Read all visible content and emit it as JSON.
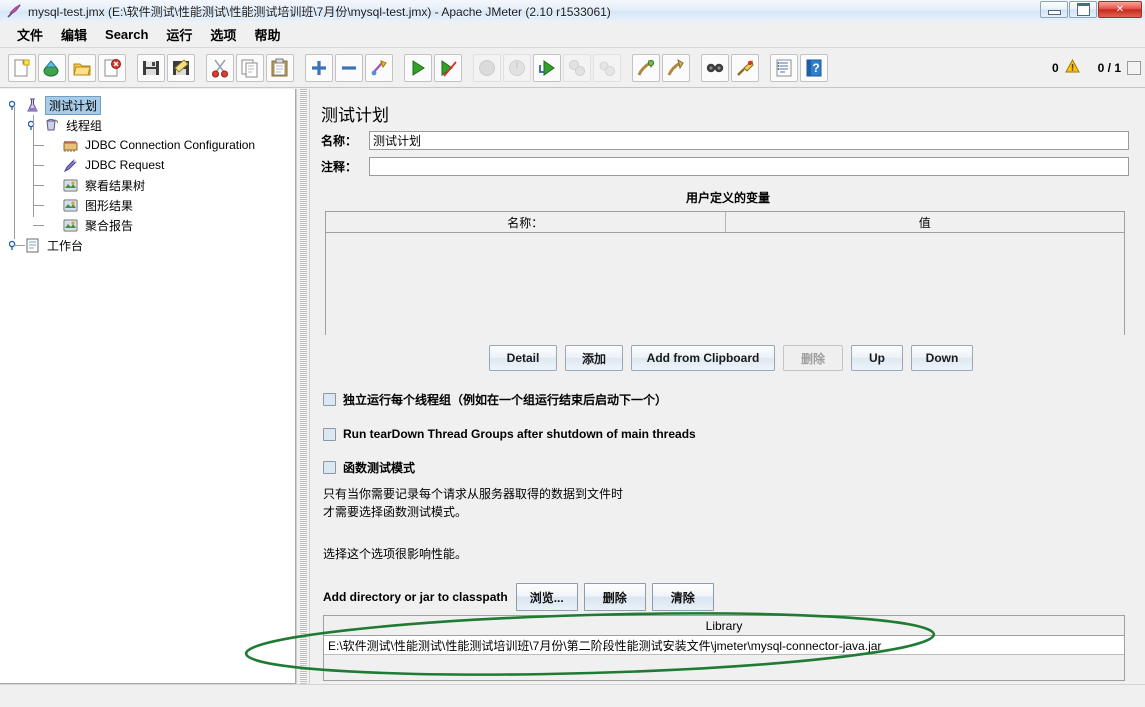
{
  "window": {
    "title": "mysql-test.jmx (E:\\软件测试\\性能测试\\性能测试培训班\\7月份\\mysql-test.jmx) - Apache JMeter (2.10 r1533061)",
    "icon": "jmeter-feather-icon",
    "minimize_label": "minimize",
    "maximize_label": "maximize",
    "close_label": "✕"
  },
  "menubar": {
    "items": [
      {
        "label": "文件",
        "name": "menu-file"
      },
      {
        "label": "编辑",
        "name": "menu-edit"
      },
      {
        "label": "Search",
        "name": "menu-search"
      },
      {
        "label": "运行",
        "name": "menu-run"
      },
      {
        "label": "选项",
        "name": "menu-options"
      },
      {
        "label": "帮助",
        "name": "menu-help"
      }
    ]
  },
  "toolbar": {
    "buttons": [
      {
        "name": "new-icon",
        "enabled": true
      },
      {
        "name": "templates-icon",
        "enabled": true
      },
      {
        "name": "open-icon",
        "enabled": true
      },
      {
        "name": "close-icon",
        "enabled": true
      },
      {
        "name": "save-icon",
        "enabled": true
      },
      {
        "name": "save-as-icon",
        "enabled": true
      },
      {
        "name": "cut-icon",
        "enabled": true
      },
      {
        "name": "copy-icon",
        "enabled": true
      },
      {
        "name": "paste-icon",
        "enabled": true
      },
      {
        "name": "expand-all-icon",
        "enabled": true
      },
      {
        "name": "collapse-all-icon",
        "enabled": true
      },
      {
        "name": "toggle-icon",
        "enabled": true
      },
      {
        "name": "start-icon",
        "enabled": true
      },
      {
        "name": "start-no-pause-icon",
        "enabled": true
      },
      {
        "name": "stop-icon",
        "enabled": false
      },
      {
        "name": "shutdown-icon",
        "enabled": false
      },
      {
        "name": "start-remote-icon",
        "enabled": true
      },
      {
        "name": "stop-remote-icon",
        "enabled": false
      },
      {
        "name": "shutdown-remote-icon",
        "enabled": false
      },
      {
        "name": "clear-icon",
        "enabled": true
      },
      {
        "name": "clear-all-icon",
        "enabled": true
      },
      {
        "name": "search-icon",
        "enabled": true
      },
      {
        "name": "search-reset-icon",
        "enabled": true
      },
      {
        "name": "function-helper-icon",
        "enabled": true
      },
      {
        "name": "help-icon",
        "enabled": true
      }
    ],
    "warning_count": "0",
    "run_count": "0 / 1"
  },
  "tree": {
    "nodes": [
      {
        "label": "测试计划",
        "icon": "test-plan-icon",
        "depth": 0,
        "selected": true,
        "name": "tree-node-test-plan"
      },
      {
        "label": "线程组",
        "icon": "thread-group-icon",
        "depth": 1,
        "selected": false,
        "name": "tree-node-thread-group"
      },
      {
        "label": "JDBC Connection Configuration",
        "icon": "jdbc-config-icon",
        "depth": 2,
        "selected": false,
        "name": "tree-node-jdbc-connection-configuration"
      },
      {
        "label": "JDBC Request",
        "icon": "jdbc-request-icon",
        "depth": 2,
        "selected": false,
        "name": "tree-node-jdbc-request"
      },
      {
        "label": "察看结果树",
        "icon": "listener-icon",
        "depth": 2,
        "selected": false,
        "name": "tree-node-view-results-tree"
      },
      {
        "label": "图形结果",
        "icon": "listener-icon",
        "depth": 2,
        "selected": false,
        "name": "tree-node-graph-results"
      },
      {
        "label": "聚合报告",
        "icon": "listener-icon",
        "depth": 2,
        "selected": false,
        "name": "tree-node-aggregate-report"
      },
      {
        "label": "工作台",
        "icon": "workbench-icon",
        "depth": 0,
        "selected": false,
        "name": "tree-node-workbench"
      }
    ]
  },
  "main": {
    "panel_title": "测试计划",
    "name_label": "名称：",
    "name_value": "测试计划",
    "comment_label": "注释：",
    "comment_value": "",
    "comment_placeholder": "",
    "vars_title": "用户定义的变量",
    "vars_columns": [
      "名称：",
      "值"
    ],
    "vars_rows": [],
    "vars_buttons": [
      {
        "label": "Detail",
        "enabled": true,
        "name": "detail-button"
      },
      {
        "label": "添加",
        "enabled": true,
        "name": "add-button"
      },
      {
        "label": "Add from Clipboard",
        "enabled": true,
        "name": "add-from-clipboard-button"
      },
      {
        "label": "删除",
        "enabled": false,
        "name": "delete-button"
      },
      {
        "label": "Up",
        "enabled": true,
        "name": "up-button"
      },
      {
        "label": "Down",
        "enabled": true,
        "name": "down-button"
      }
    ],
    "checkboxes": [
      {
        "label": "独立运行每个线程组（例如在一个组运行结束后启动下一个）",
        "checked": false,
        "name": "checkbox-run-thread-groups-consecutively"
      },
      {
        "label": "Run tearDown Thread Groups after shutdown of main threads",
        "checked": false,
        "name": "checkbox-run-teardown"
      },
      {
        "label": "函数测试模式",
        "checked": false,
        "name": "checkbox-functional-test-mode"
      }
    ],
    "notes": [
      "只有当你需要记录每个请求从服务器取得的数据到文件时",
      "才需要选择函数测试模式。",
      "选择这个选项很影响性能。"
    ],
    "classpath_label": "Add directory or jar to classpath",
    "classpath_buttons": [
      {
        "label": "浏览...",
        "name": "browse-button"
      },
      {
        "label": "删除",
        "name": "classpath-delete-button"
      },
      {
        "label": "清除",
        "name": "classpath-clear-button"
      }
    ],
    "library_header": "Library",
    "library_rows": [
      "E:\\软件测试\\性能测试\\性能测试培训班\\7月份\\第二阶段性能测试安装文件\\jmeter\\mysql-connector-java.jar"
    ]
  },
  "annotation": {
    "shape": "ellipse-highlight",
    "color": "#1f7a33"
  }
}
